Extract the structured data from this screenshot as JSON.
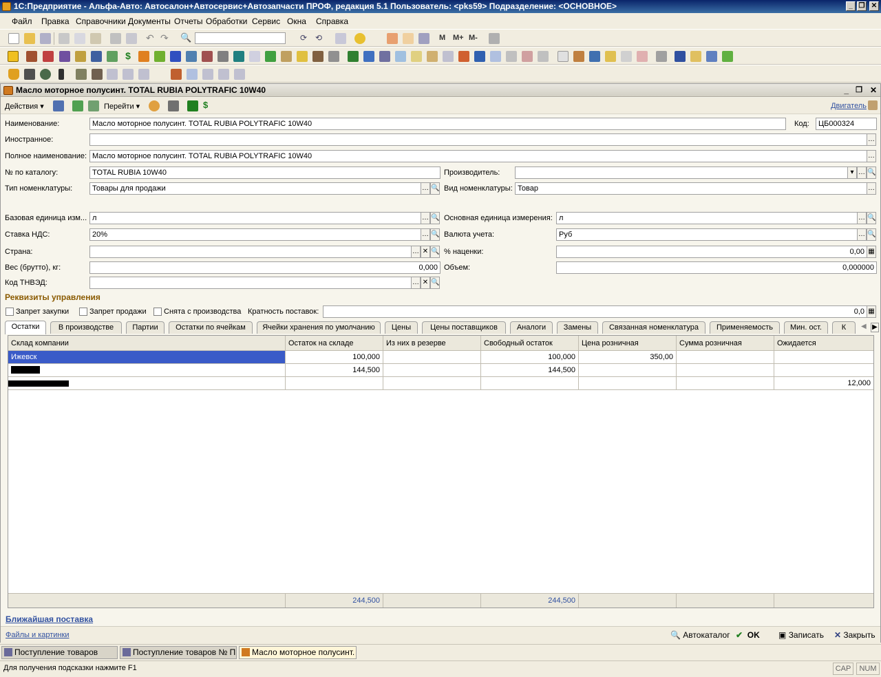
{
  "window": {
    "title": "1С:Предприятие - Альфа-Авто: Автосалон+Автосервис+Автозапчасти ПРОФ, редакция 5.1    Пользователь: <pks59>    Подразделение: <ОСНОВНОЕ>"
  },
  "menu": [
    "Файл",
    "Правка",
    "Справочники",
    "Документы",
    "Отчеты",
    "Обработки",
    "Сервис",
    "Окна",
    "Справка"
  ],
  "toolbar_text": [
    "M",
    "M+",
    "M-"
  ],
  "toolbar_icons": [
    "new-icon",
    "open-icon",
    "save-icon",
    "cut-icon",
    "copy-icon",
    "paste-icon",
    "print-icon",
    "undo-icon",
    "redo-icon",
    "find-icon"
  ],
  "document": {
    "title": "Масло моторное полусинт. TOTAL RUBIA POLYTRAFIC 10W40",
    "cmd": {
      "actions": "Действия",
      "goto": "Перейти",
      "movements": "Двигатель"
    },
    "fields": {
      "name_label": "Наименование:",
      "name_value": "Масло моторное полусинт. TOTAL RUBIA POLYTRAFIC 10W40",
      "code_label": "Код:",
      "code_value": "ЦБ000324",
      "foreign_label": "Иностранное:",
      "foreign_value": "",
      "fullname_label": "Полное наименование:",
      "fullname_value": "Масло моторное полусинт. TOTAL RUBIA POLYTRAFIC 10W40",
      "catalog_label": "№ по каталогу:",
      "catalog_value": "TOTAL RUBIA 10W40",
      "maker_label": "Производитель:",
      "maker_value": "",
      "type_label": "Тип номенклатуры:",
      "type_value": "Товары  для продажи",
      "kind_label": "Вид номенклатуры:",
      "kind_value": "Товар",
      "base_unit_label": "Базовая единица изм...",
      "base_unit_value": "л",
      "main_unit_label": "Основная единица измерения:",
      "main_unit_value": "л",
      "vat_label": "Ставка НДС:",
      "vat_value": "20%",
      "currency_label": "Валюта учета:",
      "currency_value": "Руб",
      "country_label": "Страна:",
      "country_value": "",
      "markup_label": "% наценки:",
      "markup_value": "0,00",
      "weight_label": "Вес (брутто), кг:",
      "weight_value": "0,000",
      "volume_label": "Объем:",
      "volume_value": "0,000000",
      "tnved_label": "Код ТНВЭД:",
      "tnved_value": ""
    },
    "management": {
      "title": "Реквизиты управления",
      "ban_purchase": "Запрет закупки",
      "ban_sale": "Запрет продажи",
      "discontinued": "Снята с производства",
      "multiplicity_label": "Кратность поставок:",
      "multiplicity_value": "0,0"
    },
    "tabs": [
      "Остатки",
      "В производстве",
      "Партии",
      "Остатки по ячейкам",
      "Ячейки хранения по умолчанию",
      "Цены",
      "Цены поставщиков",
      "Аналоги",
      "Замены",
      "Связанная номенклатура",
      "Применяемость",
      "Мин. ост.",
      "К"
    ],
    "table": {
      "columns": [
        "Склад компании",
        "Остаток на складе",
        "Из них в резерве",
        "Свободный остаток",
        "Цена розничная",
        "Сумма розничная",
        "Ожидается"
      ],
      "rows": [
        [
          "Ижевск",
          "100,000",
          "",
          "100,000",
          "350,00",
          "",
          ""
        ],
        [
          "",
          "144,500",
          "",
          "144,500",
          "",
          "",
          ""
        ],
        [
          "",
          "",
          "",
          "",
          "",
          "",
          "12,000"
        ]
      ],
      "totals": [
        "",
        "244,500",
        "",
        "244,500",
        "",
        "",
        ""
      ]
    },
    "nearest_delivery": "Ближайшая поставка",
    "files_link": "Файлы и картинки",
    "buttons": {
      "autocatalog": "Автокаталог",
      "ok": "OK",
      "save": "Записать",
      "close": "Закрыть"
    }
  },
  "taskbar": [
    "Поступление товаров",
    "Поступление товаров № П...",
    "Масло моторное полусинт. ..."
  ],
  "status": {
    "hint": "Для получения подсказки нажмите F1",
    "cap": "CAP",
    "num": "NUM"
  },
  "colors": {
    "selection": "#3a5bc8",
    "section": "#8a5a00",
    "link": "#3050a0"
  }
}
